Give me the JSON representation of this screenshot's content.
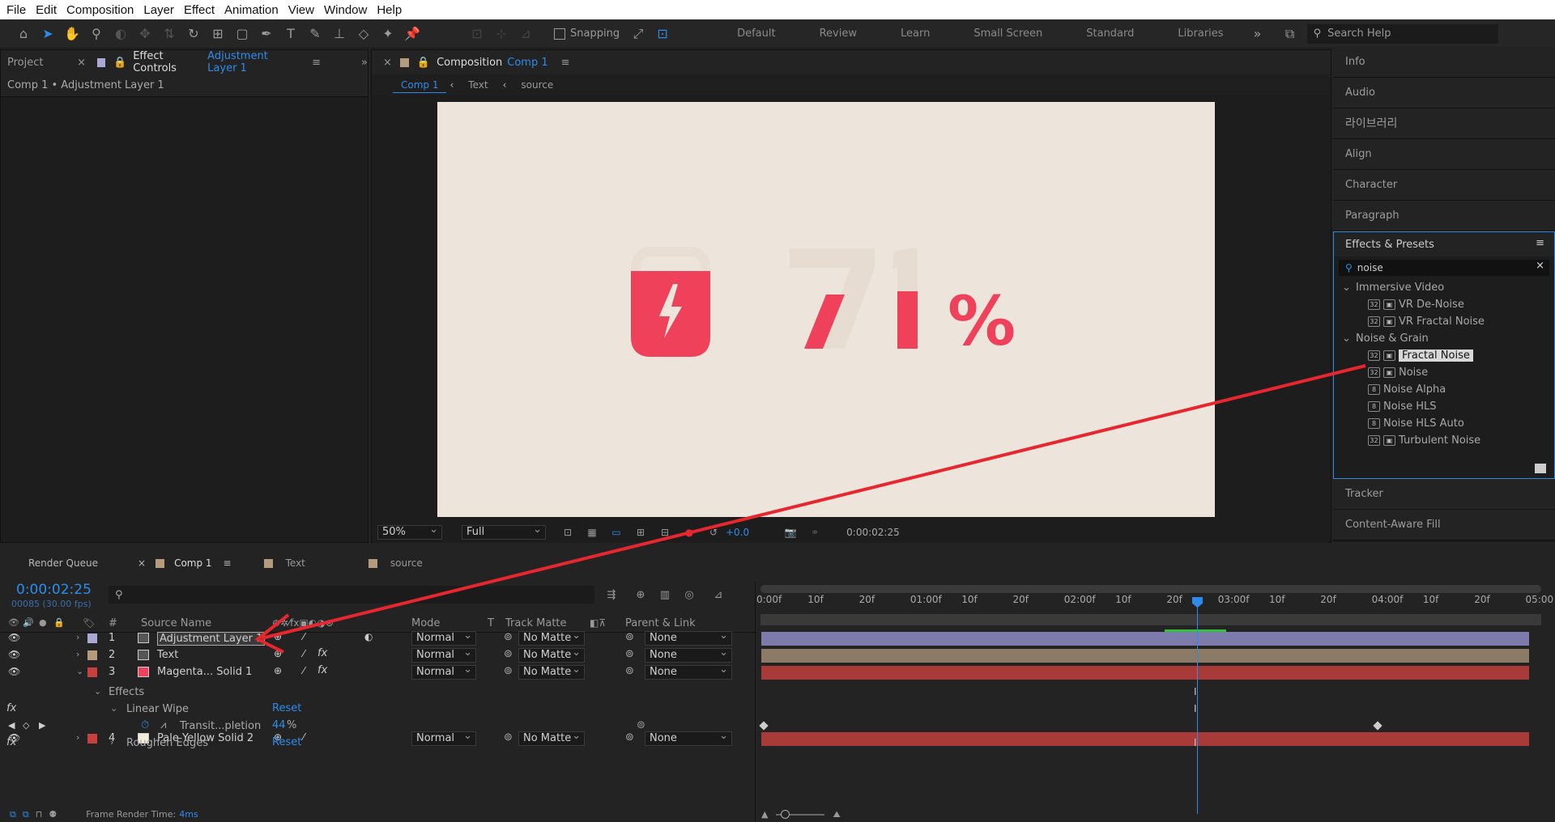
{
  "menu": [
    "File",
    "Edit",
    "Composition",
    "Layer",
    "Effect",
    "Animation",
    "View",
    "Window",
    "Help"
  ],
  "toolbar": {
    "snapping_label": "Snapping",
    "workspaces": [
      "Default",
      "Review",
      "Learn",
      "Small Screen",
      "Standard",
      "Libraries"
    ],
    "search_placeholder": "Search Help"
  },
  "left_panel": {
    "tab_project": "Project",
    "tab_effect_controls": "Effect Controls",
    "tab_effect_controls_layer": "Adjustment Layer 1",
    "breadcrumb": "Comp 1 • Adjustment Layer 1"
  },
  "comp_panel": {
    "tab_label": "Composition",
    "tab_comp": "Comp 1",
    "nav": [
      "Comp 1",
      "Text",
      "source"
    ],
    "zoom": "50%",
    "resolution": "Full",
    "exposure": "+0.0",
    "timecode": "0:00:02:25",
    "canvas_text": "71%"
  },
  "right_panel": {
    "items_top": [
      "Info",
      "Audio",
      "라이브러리",
      "Align",
      "Character",
      "Paragraph"
    ],
    "effects_title": "Effects & Presets",
    "search_value": "noise",
    "tree": [
      {
        "type": "group",
        "label": "Immersive Video"
      },
      {
        "type": "item",
        "badge": "32",
        "label": "VR De-Noise"
      },
      {
        "type": "item",
        "badge": "32",
        "label": "VR Fractal Noise"
      },
      {
        "type": "group",
        "label": "Noise & Grain"
      },
      {
        "type": "item",
        "badge": "32",
        "label": "Fractal Noise",
        "selected": true
      },
      {
        "type": "item",
        "badge": "32",
        "label": "Noise"
      },
      {
        "type": "item",
        "badge": "8",
        "label": "Noise Alpha"
      },
      {
        "type": "item",
        "badge": "8",
        "label": "Noise HLS"
      },
      {
        "type": "item",
        "badge": "8",
        "label": "Noise HLS Auto"
      },
      {
        "type": "item",
        "badge": "32",
        "label": "Turbulent Noise"
      }
    ],
    "items_bottom": [
      "Tracker",
      "Content-Aware Fill"
    ]
  },
  "timeline": {
    "tab_render_queue": "Render Queue",
    "tab_comp1": "Comp 1",
    "tab_text": "Text",
    "tab_source": "source",
    "timecode": "0:00:02:25",
    "frame_info": "00085 (30.00 fps)",
    "headers": {
      "num": "#",
      "source": "Source Name",
      "mode": "Mode",
      "t": "T",
      "track": "Track Matte",
      "parent": "Parent & Link"
    },
    "layers": [
      {
        "num": "1",
        "name": "Adjustment Layer 1",
        "mode": "Normal",
        "matte": "No Matte",
        "parent": "None",
        "color": "#a9a9d4"
      },
      {
        "num": "2",
        "name": "Text",
        "mode": "Normal",
        "matte": "No Matte",
        "parent": "None",
        "color": "#b49b7d"
      },
      {
        "num": "3",
        "name": "Magenta... Solid 1",
        "mode": "Normal",
        "matte": "No Matte",
        "parent": "None",
        "color": "#c64040"
      },
      {
        "num": "4",
        "name": "Pale Yellow Solid 2",
        "mode": "Normal",
        "matte": "No Matte",
        "parent": "None",
        "color": "#c64040"
      }
    ],
    "effects_label": "Effects",
    "fx1": "Linear Wipe",
    "fx1_prop": "Transit...pletion",
    "fx1_value": "44",
    "fx1_unit": "%",
    "fx2": "Roughen Edges",
    "reset": "Reset",
    "ruler": [
      "0:00f",
      "10f",
      "20f",
      "01:00f",
      "10f",
      "20f",
      "02:00f",
      "10f",
      "20f",
      "03:00f",
      "10f",
      "20f",
      "04:00f",
      "10f",
      "20f",
      "05:00"
    ],
    "frame_render_label": "Frame Render Time:",
    "frame_render_value": "4ms"
  },
  "colors": {
    "accent": "#2d8ceb",
    "arrow": "#e8262f",
    "accent_red": "#f0415a",
    "canvas": "#ede5dc"
  }
}
